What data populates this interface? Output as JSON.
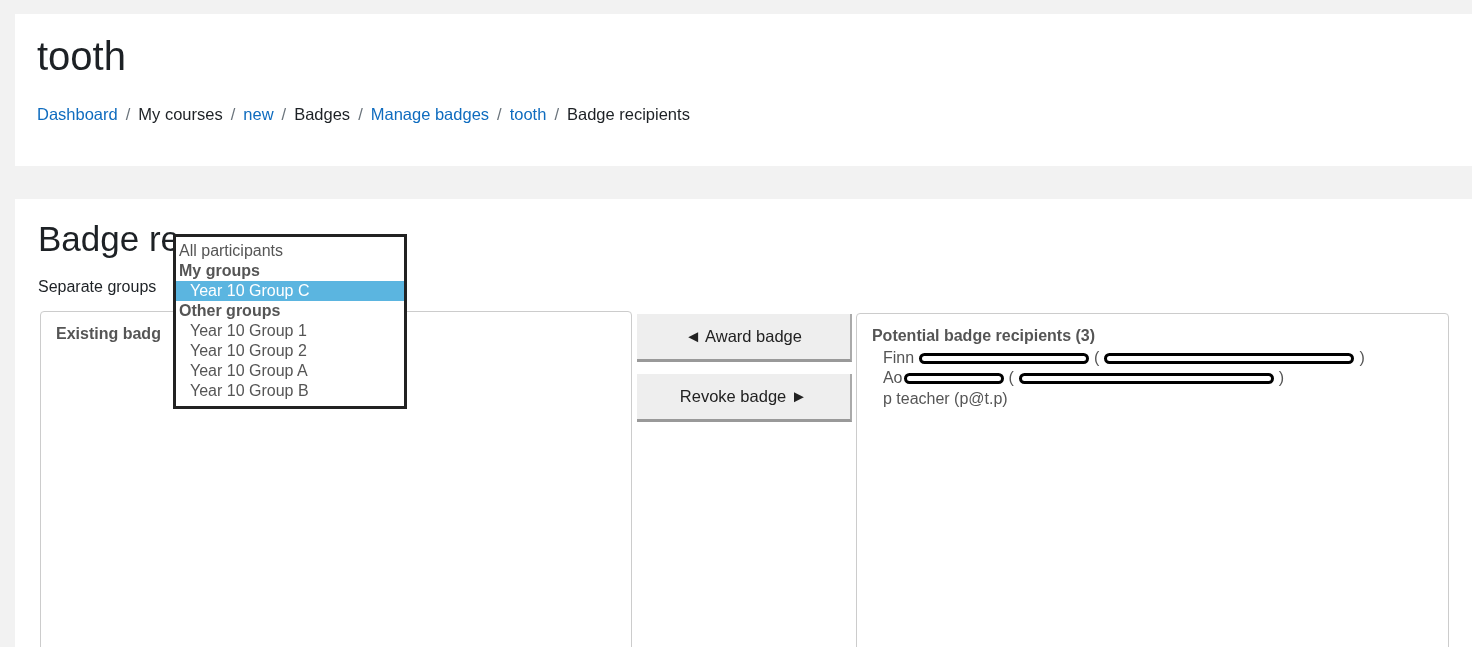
{
  "page_title": "tooth",
  "breadcrumb": [
    {
      "label": "Dashboard",
      "link": true
    },
    {
      "sep": "/",
      "label": "My courses",
      "link": false
    },
    {
      "sep": "/",
      "label": "new",
      "link": true
    },
    {
      "sep": "/",
      "label": "Badges",
      "link": false
    },
    {
      "sep": "/",
      "label": "Manage badges",
      "link": true
    },
    {
      "sep": "/",
      "label": "tooth",
      "link": true
    },
    {
      "sep": "/",
      "label": "Badge recipients",
      "link": false
    }
  ],
  "heading": "Badge re",
  "group_label": "Separate groups",
  "group_dropdown": [
    {
      "kind": "option",
      "label": "All participants",
      "selected": false
    },
    {
      "kind": "group",
      "label": "My groups"
    },
    {
      "kind": "option",
      "label": "Year 10 Group C",
      "selected": true,
      "nested": true
    },
    {
      "kind": "group",
      "label": "Other groups"
    },
    {
      "kind": "option",
      "label": "Year 10 Group 1",
      "selected": false,
      "nested": true
    },
    {
      "kind": "option",
      "label": "Year 10 Group 2",
      "selected": false,
      "nested": true
    },
    {
      "kind": "option",
      "label": "Year 10 Group A",
      "selected": false,
      "nested": true
    },
    {
      "kind": "option",
      "label": "Year 10 Group B",
      "selected": false,
      "nested": true
    }
  ],
  "existing": {
    "title": "Existing badg"
  },
  "buttons": [
    "◄ Award badge",
    "Revoke badge ►"
  ],
  "potential": {
    "title": "Potential badge recipients (3)",
    "recipients": [
      {
        "segments": [
          {
            "kind": "text",
            "text": "Finn"
          },
          {
            "kind": "namemark"
          },
          {
            "kind": "text",
            "text": "("
          },
          {
            "kind": "emailmark"
          },
          {
            "kind": "text",
            "text": ")"
          }
        ]
      },
      {
        "segments": [
          {
            "kind": "text",
            "text": "Ao"
          },
          {
            "kind": "shortmark"
          },
          {
            "kind": "text",
            "text": "("
          },
          {
            "kind": "emailmark"
          },
          {
            "kind": "text",
            "text": ")"
          }
        ]
      },
      {
        "segments": [
          {
            "kind": "text",
            "text": "p teacher (p@t.p)"
          }
        ]
      }
    ]
  }
}
